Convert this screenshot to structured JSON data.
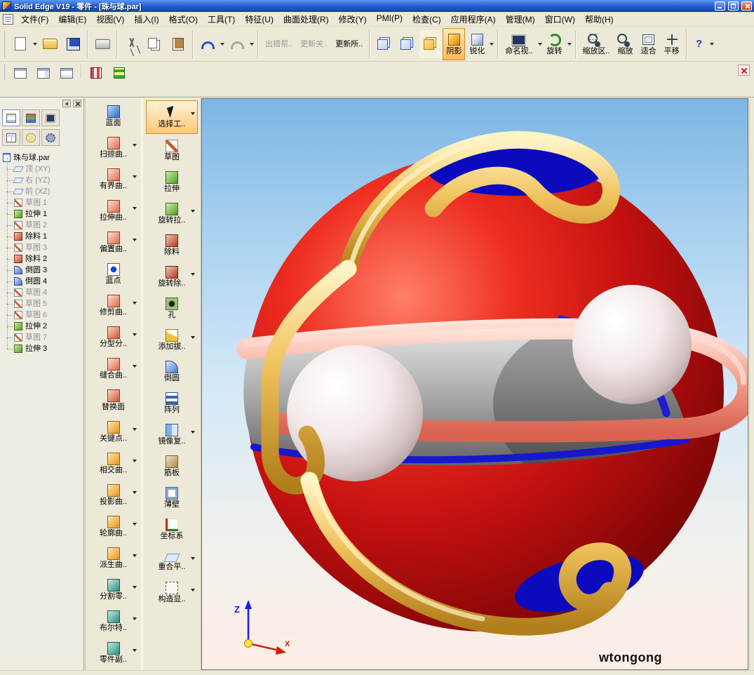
{
  "window": {
    "title": "Solid Edge V19 - 零件 - [珠与球.par]"
  },
  "menu": {
    "items": [
      "文件(F)",
      "编辑(E)",
      "视图(V)",
      "插入(I)",
      "格式(O)",
      "工具(T)",
      "特征(U)",
      "曲面处理(R)",
      "修改(Y)",
      "PMI(P)",
      "检查(C)",
      "应用程序(A)",
      "管理(M)",
      "窗口(W)",
      "帮助(H)"
    ]
  },
  "toolbar": {
    "error_help": "出错帮..",
    "update_links": "更新关..",
    "update_all": "更新所..",
    "shaded": "阴影",
    "sharpen": "锐化",
    "named_views": "命名视..",
    "rotate": "旋转",
    "zoom_area": "缩放区..",
    "zoom": "缩放",
    "fit": "适合",
    "pan": "平移",
    "help": "?"
  },
  "edgebar": {
    "root": "珠与球.par",
    "items": [
      {
        "label": "顶 (XY)",
        "type": "plane",
        "muted": true
      },
      {
        "label": "右 (YZ)",
        "type": "plane",
        "muted": true
      },
      {
        "label": "前 (XZ)",
        "type": "plane",
        "muted": true
      },
      {
        "label": "草图 1",
        "type": "sketch",
        "muted": true
      },
      {
        "label": "拉伸 1",
        "type": "extrude",
        "muted": false
      },
      {
        "label": "草图 2",
        "type": "sketch",
        "muted": true
      },
      {
        "label": "除料 1",
        "type": "cut",
        "muted": false
      },
      {
        "label": "草图 3",
        "type": "sketch",
        "muted": true
      },
      {
        "label": "除料 2",
        "type": "cut",
        "muted": false
      },
      {
        "label": "倒圆 3",
        "type": "round",
        "muted": false
      },
      {
        "label": "倒圆 4",
        "type": "round",
        "muted": false
      },
      {
        "label": "草图 4",
        "type": "sketch",
        "muted": true
      },
      {
        "label": "草图 5",
        "type": "sketch",
        "muted": true
      },
      {
        "label": "草图 6",
        "type": "sketch",
        "muted": true
      },
      {
        "label": "拉伸 2",
        "type": "extrude",
        "muted": false
      },
      {
        "label": "草图 7",
        "type": "sketch",
        "muted": true
      },
      {
        "label": "拉伸 3",
        "type": "extrude",
        "muted": false
      }
    ]
  },
  "surface_tools": {
    "items": [
      {
        "label": "蓝面",
        "icon": "bluesurf-icon",
        "arrow": false
      },
      {
        "label": "扫掠曲..",
        "icon": "swept-surface-icon",
        "arrow": true
      },
      {
        "label": "有界曲..",
        "icon": "bounded-surface-icon",
        "arrow": true
      },
      {
        "label": "拉伸曲..",
        "icon": "extruded-surface-icon",
        "arrow": true
      },
      {
        "label": "偏置曲..",
        "icon": "offset-surface-icon",
        "arrow": true
      },
      {
        "label": "蓝点",
        "icon": "bluedot-icon",
        "arrow": false
      },
      {
        "label": "修剪曲..",
        "icon": "trim-surface-icon",
        "arrow": true
      },
      {
        "label": "分型分..",
        "icon": "parting-split-icon",
        "arrow": true
      },
      {
        "label": "缝合曲..",
        "icon": "stitch-surface-icon",
        "arrow": true
      },
      {
        "label": "替换面",
        "icon": "replace-face-icon",
        "arrow": false
      },
      {
        "label": "关键点..",
        "icon": "keypoint-curve-icon",
        "arrow": true
      },
      {
        "label": "相交曲..",
        "icon": "intersection-curve-icon",
        "arrow": true
      },
      {
        "label": "投影曲..",
        "icon": "project-curve-icon",
        "arrow": true
      },
      {
        "label": "轮廓曲..",
        "icon": "contour-curve-icon",
        "arrow": true
      },
      {
        "label": "派生曲..",
        "icon": "derived-curve-icon",
        "arrow": true
      },
      {
        "label": "分割零..",
        "icon": "split-part-icon",
        "arrow": true
      },
      {
        "label": "布尔特..",
        "icon": "boolean-feature-icon",
        "arrow": true
      },
      {
        "label": "零件副..",
        "icon": "part-copy-icon",
        "arrow": true
      }
    ]
  },
  "feature_tools": {
    "items": [
      {
        "label": "选择工..",
        "icon": "select-tool-icon",
        "active": true,
        "arrow": true
      },
      {
        "label": "草图",
        "icon": "sketch-icon",
        "arrow": false
      },
      {
        "label": "拉伸",
        "icon": "protrusion-icon",
        "arrow": false
      },
      {
        "label": "旋转拉..",
        "icon": "revolved-protrusion-icon",
        "arrow": true
      },
      {
        "label": "除料",
        "icon": "cutout-icon",
        "arrow": false
      },
      {
        "label": "旋转除..",
        "icon": "revolved-cutout-icon",
        "arrow": true
      },
      {
        "label": "孔",
        "icon": "hole-icon",
        "arrow": false
      },
      {
        "label": "添加拔..",
        "icon": "draft-icon",
        "arrow": true
      },
      {
        "label": "倒圆",
        "icon": "round-icon",
        "arrow": false
      },
      {
        "label": "阵列",
        "icon": "pattern-icon",
        "arrow": false
      },
      {
        "label": "镜像复..",
        "icon": "mirror-copy-icon",
        "arrow": true
      },
      {
        "label": "筋板",
        "icon": "rib-icon",
        "arrow": false
      },
      {
        "label": "薄壁",
        "icon": "thin-wall-icon",
        "arrow": false
      },
      {
        "label": "坐标系",
        "icon": "coordinate-system-icon",
        "arrow": false
      },
      {
        "label": "重合平..",
        "icon": "coincident-plane-icon",
        "arrow": true
      },
      {
        "label": "构造显..",
        "icon": "construction-display-icon",
        "arrow": true
      }
    ]
  },
  "viewport": {
    "watermark": "wtongong",
    "triad": {
      "z": "Z",
      "x": "X"
    },
    "colors": {
      "sphere_red": "#cc1111",
      "tube_gold": "#e8b84a",
      "tube_pink": "#f4907e",
      "ring_blue": "#0d0dc0",
      "pearl_white": "#f2e8e6",
      "active_accent": "#ffb95e",
      "titlebar_blue": "#2763d6"
    }
  }
}
